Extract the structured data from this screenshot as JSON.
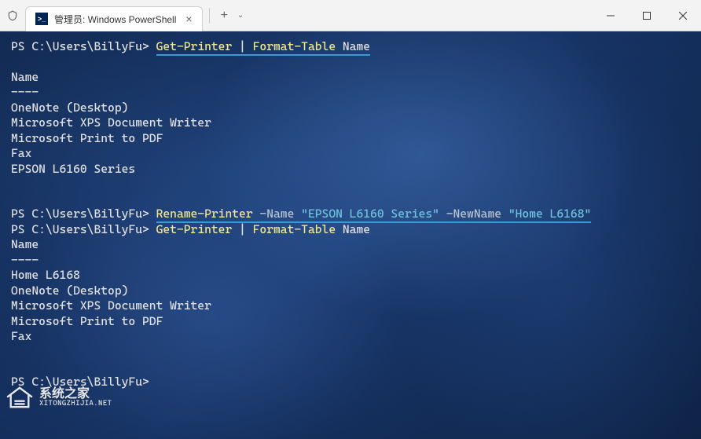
{
  "titlebar": {
    "tab_title": "管理员: Windows PowerShell",
    "ps_icon": ">_"
  },
  "session": {
    "prompt": "PS C:\\Users\\BillyFu> ",
    "cmd1_getprinter": "Get-Printer",
    "cmd1_pipe": " | ",
    "cmd1_format": "Format-Table",
    "cmd1_arg": " Name",
    "header": "Name",
    "dashes": "----",
    "list1_0": "OneNote (Desktop)",
    "list1_1": "Microsoft XPS Document Writer",
    "list1_2": "Microsoft Print to PDF",
    "list1_3": "Fax",
    "list1_4": "EPSON L6160 Series",
    "cmd2_rename": "Rename-Printer",
    "cmd2_name_flag": " -Name ",
    "cmd2_name_val": "\"EPSON L6160 Series\"",
    "cmd2_newname_flag": " -NewName ",
    "cmd2_newname_val": "\"Home L6168\"",
    "cmd3_getprinter": "Get-Printer",
    "cmd3_pipe": " | ",
    "cmd3_format": "Format-Table",
    "cmd3_arg": " Name",
    "list2_0": "Home L6168",
    "list2_1": "OneNote (Desktop)",
    "list2_2": "Microsoft XPS Document Writer",
    "list2_3": "Microsoft Print to PDF",
    "list2_4": "Fax"
  },
  "watermark": {
    "main": "系统之家",
    "sub": "XITONGZHIJIA.NET"
  }
}
